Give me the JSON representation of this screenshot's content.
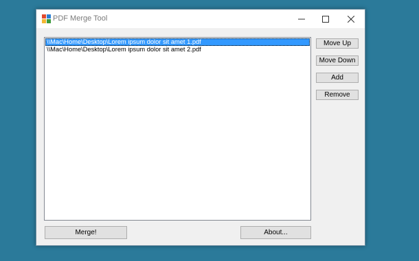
{
  "window": {
    "title": "PDF Merge Tool",
    "app_icon": "pdf-merge-app-icon",
    "controls": {
      "minimize_icon": "minimize-icon",
      "maximize_icon": "maximize-icon",
      "close_icon": "close-icon"
    }
  },
  "file_list": {
    "items": [
      {
        "path": "\\\\Mac\\Home\\Desktop\\Lorem ipsum dolor sit amet 1.pdf",
        "selected": true
      },
      {
        "path": "\\\\Mac\\Home\\Desktop\\Lorem ipsum dolor sit amet 2.pdf",
        "selected": false
      }
    ]
  },
  "side_buttons": {
    "move_up": "Move Up",
    "move_down": "Move Down",
    "add": "Add",
    "remove": "Remove"
  },
  "bottom_buttons": {
    "merge": "Merge!",
    "about": "About..."
  },
  "colors": {
    "desktop": "#2b7a9a",
    "selection": "#3399ff",
    "window_bg": "#f0f0f0"
  }
}
